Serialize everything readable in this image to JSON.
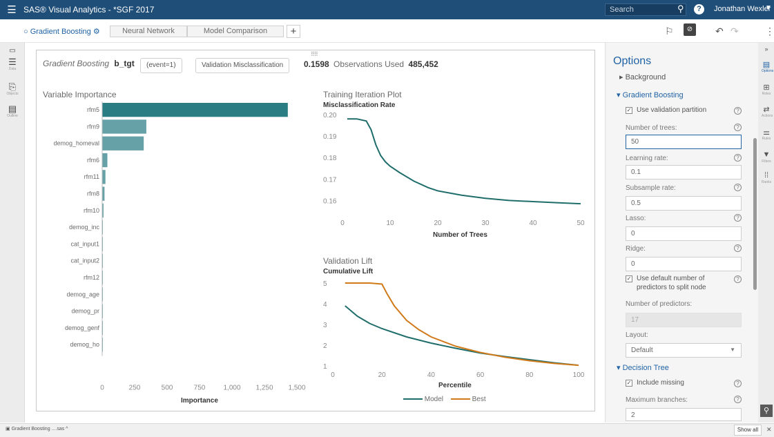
{
  "app": {
    "title": "SAS® Visual Analytics - *SGF 2017",
    "search_placeholder": "Search",
    "user": "Jonathan Wexler"
  },
  "tabs": [
    {
      "label": "Gradient Boosting"
    },
    {
      "label": "Neural Network"
    },
    {
      "label": "Model Comparison"
    }
  ],
  "header": {
    "model": "Gradient Boosting",
    "target": "b_tgt",
    "event": "(event=1)",
    "metric_label": "Validation Misclassification",
    "metric_value": "0.1598",
    "obs_label": "Observations Used",
    "obs_value": "485,452"
  },
  "left_rail": [
    "Data",
    "Objects",
    "Outline"
  ],
  "chart_data": [
    {
      "type": "bar",
      "title": "Variable Importance",
      "xlabel": "Importance",
      "categories": [
        "rfm5",
        "rfm9",
        "demog_homeval",
        "rfm6",
        "rfm11",
        "rfm8",
        "rfm10",
        "demog_inc",
        "cat_input1",
        "cat_input2",
        "rfm12",
        "demog_age",
        "demog_pr",
        "demog_genf",
        "demog_ho"
      ],
      "values": [
        1430,
        340,
        320,
        40,
        25,
        18,
        10,
        3,
        2,
        2,
        1,
        1,
        1,
        1,
        1
      ],
      "xticks": [
        "0",
        "250",
        "500",
        "750",
        "1,000",
        "1,250",
        "1,500"
      ],
      "xlim": [
        0,
        1500
      ],
      "color": "#2a7d83"
    },
    {
      "type": "line",
      "title": "Training Iteration Plot",
      "ylabel": "Misclassification Rate",
      "xlabel": "Number of Trees",
      "x": [
        1,
        3,
        5,
        6,
        7,
        8,
        9,
        10,
        12,
        15,
        18,
        20,
        25,
        30,
        35,
        40,
        45,
        50
      ],
      "y": [
        0.198,
        0.198,
        0.197,
        0.193,
        0.186,
        0.181,
        0.178,
        0.176,
        0.173,
        0.169,
        0.166,
        0.1645,
        0.1625,
        0.161,
        0.16,
        0.1595,
        0.159,
        0.1585
      ],
      "xticks": [
        "0",
        "10",
        "20",
        "30",
        "40",
        "50"
      ],
      "yticks": [
        "0.16",
        "0.17",
        "0.18",
        "0.19",
        "0.20"
      ],
      "xlim": [
        0,
        50
      ],
      "ylim": [
        0.155,
        0.2
      ],
      "color": "#1f6d6b"
    },
    {
      "type": "line",
      "title": "Validation Lift",
      "ylabel": "Cumulative Lift",
      "xlabel": "Percentile",
      "series": [
        {
          "name": "Model",
          "x": [
            5,
            10,
            15,
            20,
            30,
            40,
            50,
            60,
            70,
            80,
            90,
            100
          ],
          "y": [
            3.9,
            3.4,
            3.05,
            2.8,
            2.4,
            2.1,
            1.85,
            1.62,
            1.45,
            1.3,
            1.15,
            1.03
          ],
          "color": "#1f6d6b"
        },
        {
          "name": "Best",
          "x": [
            5,
            10,
            15,
            20,
            22,
            25,
            30,
            35,
            40,
            50,
            60,
            70,
            80,
            90,
            100
          ],
          "y": [
            5.0,
            5.0,
            5.0,
            4.95,
            4.5,
            3.9,
            3.2,
            2.75,
            2.4,
            1.95,
            1.65,
            1.42,
            1.25,
            1.12,
            1.03
          ],
          "color": "#d07a1a"
        }
      ],
      "xticks": [
        "0",
        "20",
        "40",
        "60",
        "80",
        "100"
      ],
      "yticks": [
        "1",
        "2",
        "3",
        "4",
        "5"
      ],
      "xlim": [
        0,
        100
      ],
      "ylim": [
        0.8,
        5.2
      ]
    }
  ],
  "options": {
    "title": "Options",
    "background_label": "Background",
    "gb_label": "Gradient Boosting",
    "use_validation": "Use validation partition",
    "trees_label": "Number of trees:",
    "trees_value": "50",
    "lr_label": "Learning rate:",
    "lr_value": "0.1",
    "subsample_label": "Subsample rate:",
    "subsample_value": "0.5",
    "lasso_label": "Lasso:",
    "lasso_value": "0",
    "ridge_label": "Ridge:",
    "ridge_value": "0",
    "default_predictors_1": "Use default number of",
    "default_predictors_2": "predictors to split node",
    "npred_label": "Number of predictors:",
    "npred_value": "17",
    "layout_label": "Layout:",
    "layout_value": "Default",
    "dt_label": "Decision Tree",
    "include_missing": "Include missing",
    "max_branches_label": "Maximum branches:",
    "max_branches_value": "2"
  },
  "right_rail": [
    "Options",
    "Roles",
    "Actions",
    "Rules",
    "Filters",
    "Ranks"
  ],
  "bottom": {
    "file": "Gradient Boosting ....sas",
    "show_all": "Show all"
  }
}
